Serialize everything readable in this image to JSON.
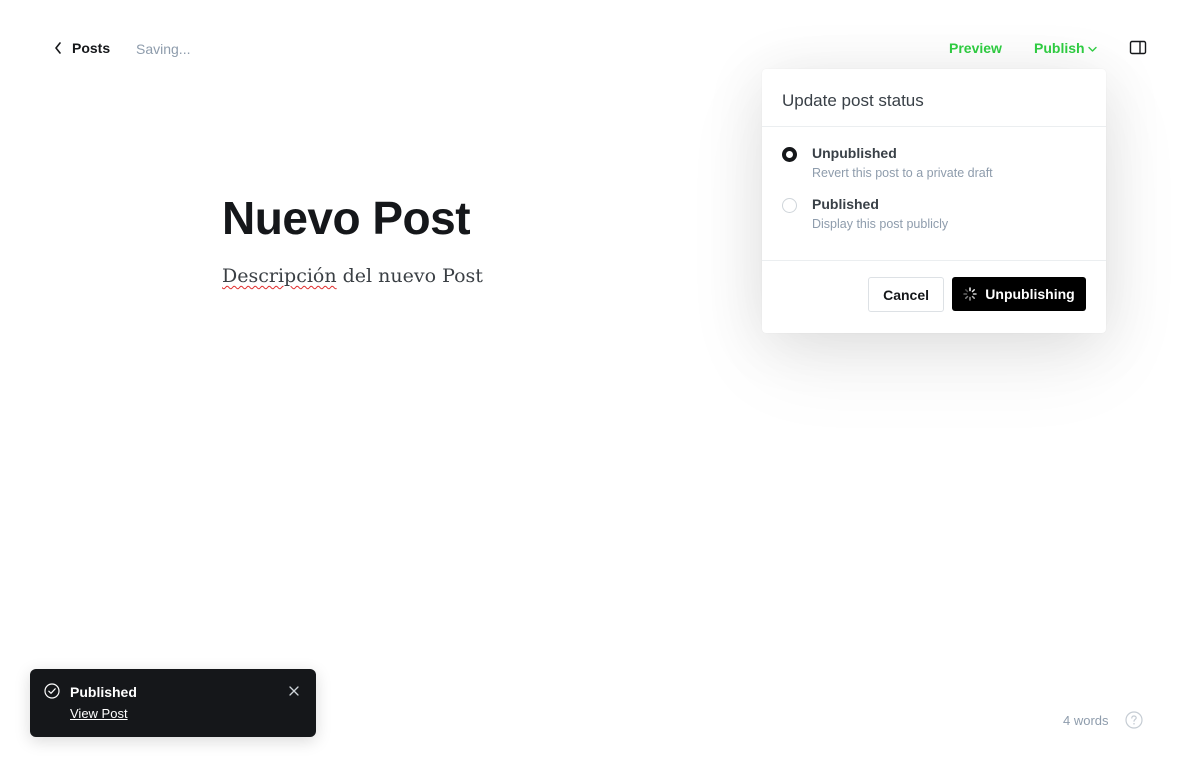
{
  "header": {
    "back_label": "Posts",
    "status_text": "Saving...",
    "preview_label": "Preview",
    "publish_label": "Publish"
  },
  "editor": {
    "title": "Nuevo Post",
    "description_misspelled": "Descripción",
    "description_rest": " del nuevo Post"
  },
  "popover": {
    "heading": "Update post status",
    "options": [
      {
        "title": "Unpublished",
        "description": "Revert this post to a private draft",
        "selected": true
      },
      {
        "title": "Published",
        "description": "Display this post publicly",
        "selected": false
      }
    ],
    "cancel_label": "Cancel",
    "confirm_label": "Unpublishing"
  },
  "toast": {
    "title": "Published",
    "link_label": "View Post"
  },
  "footer": {
    "word_count": "4 words"
  },
  "colors": {
    "accent_green": "#30cf43",
    "dark": "#15171a",
    "muted": "#8e9cac",
    "spellcheck_red": "#e02b2b"
  },
  "icons": {
    "back": "chevron-left-icon",
    "publish_caret": "chevron-down-icon",
    "sidebar": "sidebar-toggle-icon",
    "spinner": "spinner-icon",
    "toast_check": "check-circle-icon",
    "toast_close": "close-icon",
    "help": "question-circle-icon"
  }
}
